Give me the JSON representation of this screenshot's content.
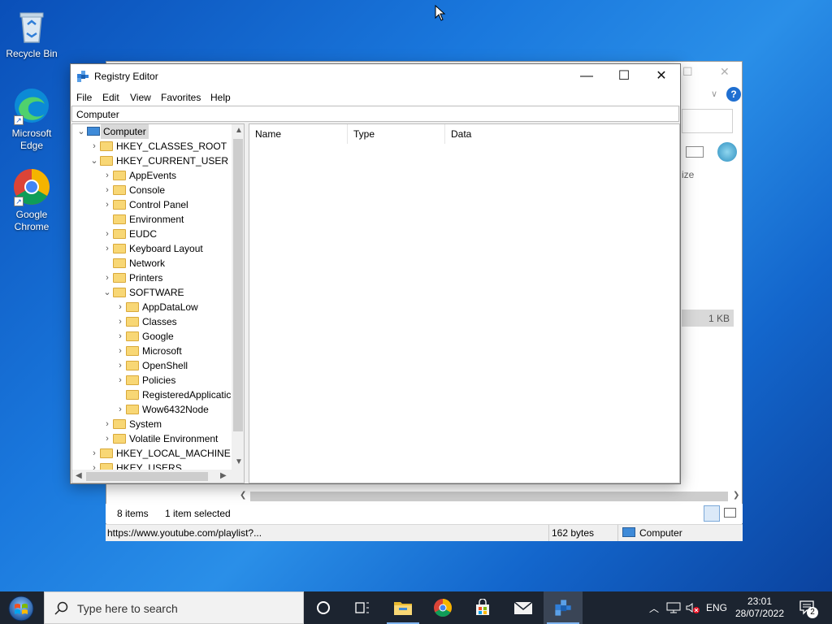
{
  "desktop": {
    "icons": [
      {
        "label": "Recycle Bin"
      },
      {
        "label": "Microsoft Edge"
      },
      {
        "label": "Google Chrome"
      }
    ]
  },
  "background_window": {
    "status_items": "8 items",
    "status_selected": "1 item selected",
    "size_header": "ize",
    "file_size": "1 KB",
    "url": "https://www.youtube.com/playlist?...",
    "bytes": "162 bytes",
    "location": "Computer"
  },
  "regedit": {
    "title": "Registry Editor",
    "menu": [
      "File",
      "Edit",
      "View",
      "Favorites",
      "Help"
    ],
    "address": "Computer",
    "columns": [
      "Name",
      "Type",
      "Data"
    ],
    "tree": [
      {
        "label": "Computer",
        "level": 0,
        "state": "expanded",
        "selected": true
      },
      {
        "label": "HKEY_CLASSES_ROOT",
        "level": 1,
        "state": "collapsed"
      },
      {
        "label": "HKEY_CURRENT_USER",
        "level": 1,
        "state": "expanded"
      },
      {
        "label": "AppEvents",
        "level": 2,
        "state": "collapsed"
      },
      {
        "label": "Console",
        "level": 2,
        "state": "collapsed"
      },
      {
        "label": "Control Panel",
        "level": 2,
        "state": "collapsed"
      },
      {
        "label": "Environment",
        "level": 2,
        "state": "leaf"
      },
      {
        "label": "EUDC",
        "level": 2,
        "state": "collapsed"
      },
      {
        "label": "Keyboard Layout",
        "level": 2,
        "state": "collapsed"
      },
      {
        "label": "Network",
        "level": 2,
        "state": "leaf"
      },
      {
        "label": "Printers",
        "level": 2,
        "state": "collapsed"
      },
      {
        "label": "SOFTWARE",
        "level": 2,
        "state": "expanded"
      },
      {
        "label": "AppDataLow",
        "level": 3,
        "state": "collapsed"
      },
      {
        "label": "Classes",
        "level": 3,
        "state": "collapsed"
      },
      {
        "label": "Google",
        "level": 3,
        "state": "collapsed"
      },
      {
        "label": "Microsoft",
        "level": 3,
        "state": "collapsed"
      },
      {
        "label": "OpenShell",
        "level": 3,
        "state": "collapsed"
      },
      {
        "label": "Policies",
        "level": 3,
        "state": "collapsed"
      },
      {
        "label": "RegisteredApplicatic",
        "level": 3,
        "state": "leaf"
      },
      {
        "label": "Wow6432Node",
        "level": 3,
        "state": "collapsed"
      },
      {
        "label": "System",
        "level": 2,
        "state": "collapsed"
      },
      {
        "label": "Volatile Environment",
        "level": 2,
        "state": "collapsed"
      },
      {
        "label": "HKEY_LOCAL_MACHINE",
        "level": 1,
        "state": "collapsed"
      },
      {
        "label": "HKEY_USERS",
        "level": 1,
        "state": "collapsed"
      }
    ]
  },
  "taskbar": {
    "search_placeholder": "Type here to search",
    "language": "ENG",
    "time": "23:01",
    "date": "28/07/2022",
    "notification_count": "2"
  }
}
